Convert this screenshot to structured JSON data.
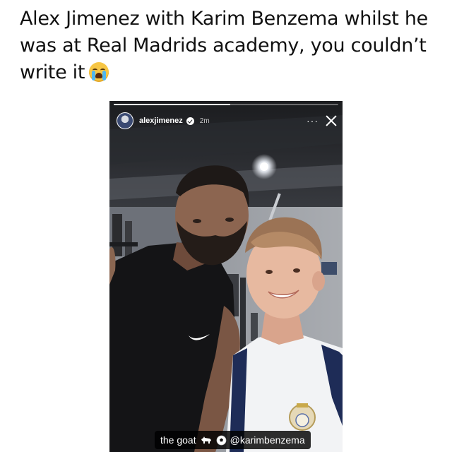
{
  "post": {
    "line1": "Alex Jimenez with Karim Benzema whilst he",
    "line2": "was at Real Madrids academy, you couldn’t",
    "line3": "write it",
    "emoji": "loudly-crying-face"
  },
  "story": {
    "username": "alexjimenez",
    "timestamp": "2m",
    "more_label": "···",
    "progress": 0.52,
    "caption": {
      "text": "the goat",
      "goat_emoji": "goat-icon",
      "mention": "@karimbenzema"
    }
  },
  "colors": {
    "story_bg": "#1d1e21",
    "caption_bg": "#000000",
    "text": "#111111"
  }
}
